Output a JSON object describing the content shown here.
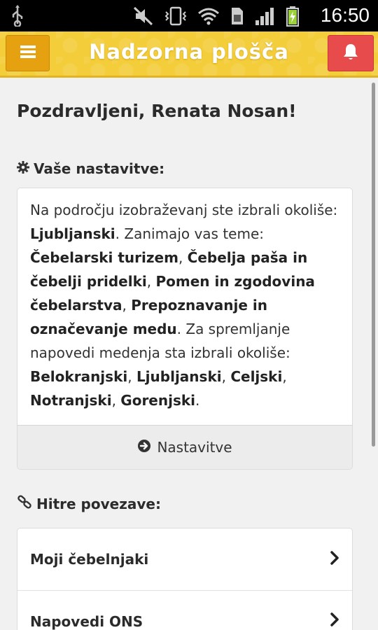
{
  "status_bar": {
    "time": "16:50"
  },
  "header": {
    "title": "Nadzorna plošča"
  },
  "greeting": "Pozdravljeni, Renata Nosan!",
  "settings": {
    "heading": "Vaše nastavitve:",
    "text_1": "Na področju izobraževanj ste izbrali okoliše: ",
    "region": "Ljubljanski",
    "text_2": ". Zanimajo vas teme: ",
    "topics": [
      "Čebelarski turizem",
      "Čebelja paša in čebelji pridelki",
      "Pomen in zgodovina čebelarstva",
      "Prepoznavanje in označevanje medu"
    ],
    "sep": ", ",
    "text_3": ". Za spremljanje napovedi medenja sta izbrali okoliše: ",
    "forecast_regions": [
      "Belokranjski",
      "Ljubljanski",
      "Celjski",
      "Notranjski",
      "Gorenjski"
    ],
    "end": ".",
    "button_label": "Nastavitve"
  },
  "quick_links": {
    "heading": "Hitre povezave:",
    "items": [
      {
        "label": "Moji čebelnjaki"
      },
      {
        "label": "Napovedi ONS"
      }
    ]
  },
  "colors": {
    "header_bg": "#f4cd3a",
    "menu_button": "#e5a10f",
    "bell_button": "#e84b4b"
  },
  "icons": [
    "usb-icon",
    "mute-icon",
    "vibrate-icon",
    "wifi-icon",
    "sim-icon",
    "signal-icon",
    "battery-icon",
    "menu-icon",
    "bell-icon",
    "gear-icon",
    "arrow-circle-right-icon",
    "link-icon",
    "chevron-right-icon"
  ]
}
